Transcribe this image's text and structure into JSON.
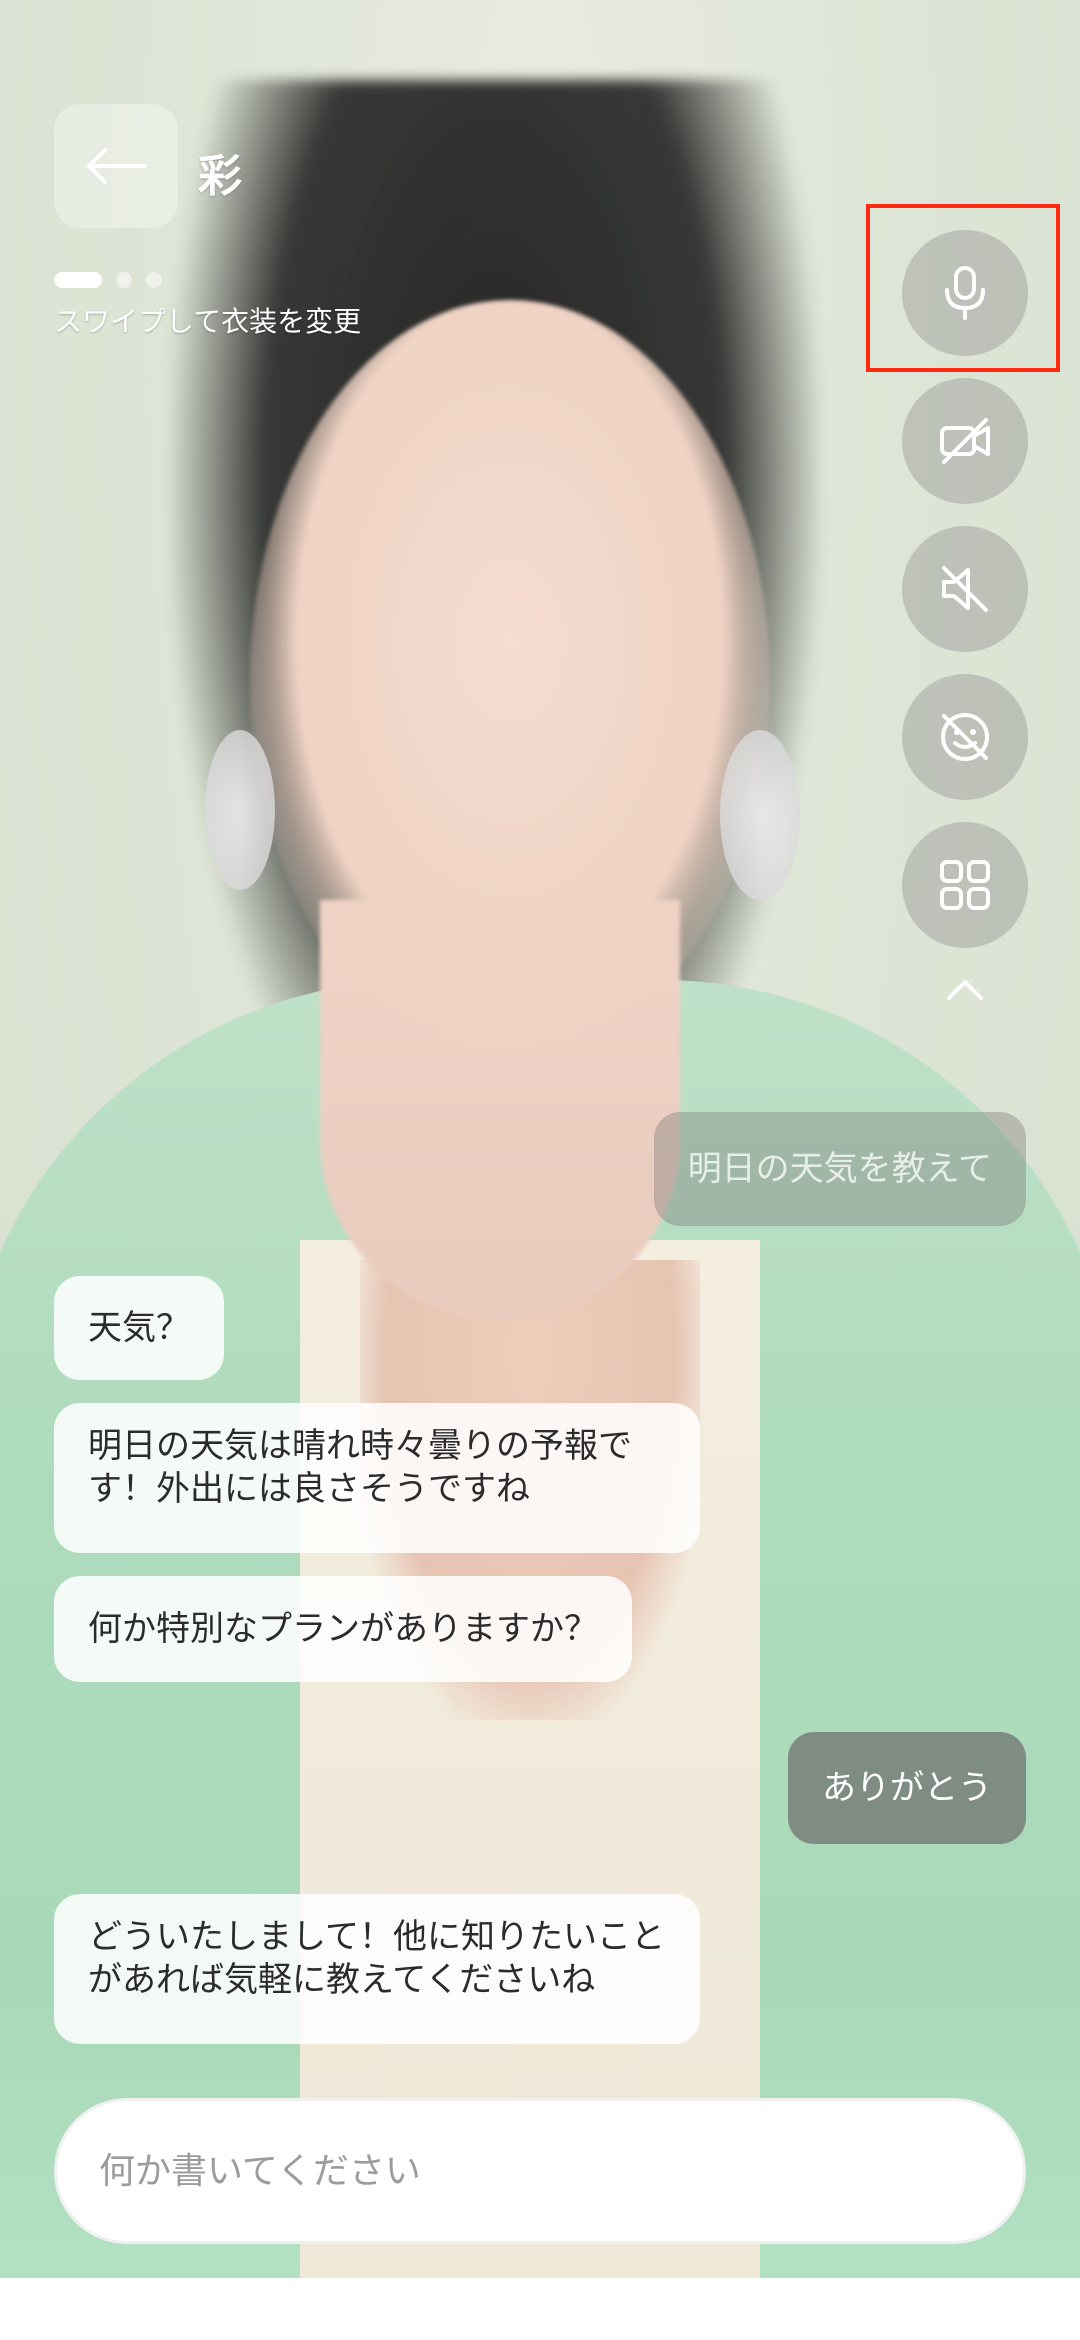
{
  "header": {
    "back_icon": "arrow-left-icon",
    "character_name": "彩",
    "swipe_hint": "スワイプして衣装を変更",
    "outfit_pages": 3,
    "outfit_active_index": 0
  },
  "controls": [
    {
      "name": "microphone",
      "icon": "microphone-icon",
      "highlighted": true
    },
    {
      "name": "camera-off",
      "icon": "camera-off-icon"
    },
    {
      "name": "speaker-muted",
      "icon": "speaker-muted-icon"
    },
    {
      "name": "emoji-off",
      "icon": "emoji-off-icon"
    },
    {
      "name": "menu-grid",
      "icon": "grid-icon"
    },
    {
      "name": "collapse",
      "icon": "chevron-up-icon"
    }
  ],
  "messages": [
    {
      "role": "user",
      "text": "明日の天気を教えて",
      "style": "faded"
    },
    {
      "role": "bot",
      "text": "天気？"
    },
    {
      "role": "bot",
      "text": "明日の天気は晴れ時々曇りの予報です！外出には良さそうですね"
    },
    {
      "role": "bot",
      "text": "何か特別なプランがありますか？"
    },
    {
      "role": "user",
      "text": "ありがとう"
    },
    {
      "role": "bot",
      "text": "どういたしまして！他に知りたいことがあれば気軽に教えてくださいね"
    }
  ],
  "input": {
    "placeholder": "何か書いてください",
    "value": ""
  },
  "colors": {
    "highlight": "#ff2a12",
    "jacket": "#aedbbd"
  }
}
